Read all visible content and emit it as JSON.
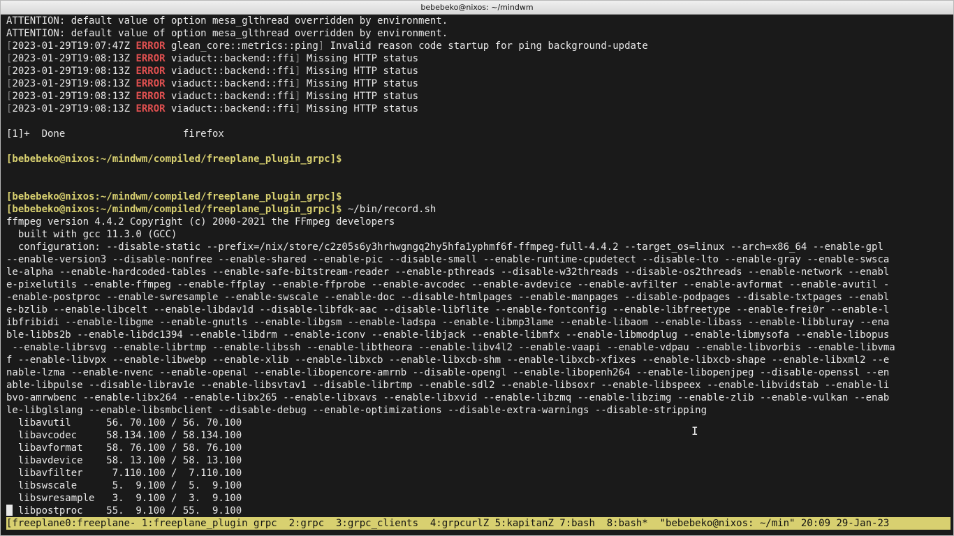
{
  "window": {
    "title": "bebebeko@nixos: ~/mindwm"
  },
  "terminal": {
    "lines": [
      {
        "text": "ATTENTION: default value of option mesa_glthread overridden by environment."
      },
      {
        "text": "ATTENTION: default value of option mesa_glthread overridden by environment."
      },
      {
        "text": "[2023-01-29T19:07:47Z ERROR glean_core::metrics::ping] Invalid reason code startup for ping background-update"
      },
      {
        "text": "[2023-01-29T19:08:13Z ERROR viaduct::backend::ffi] Missing HTTP status"
      },
      {
        "text": "[2023-01-29T19:08:13Z ERROR viaduct::backend::ffi] Missing HTTP status"
      },
      {
        "text": "[2023-01-29T19:08:13Z ERROR viaduct::backend::ffi] Missing HTTP status"
      },
      {
        "text": "[2023-01-29T19:08:13Z ERROR viaduct::backend::ffi] Missing HTTP status"
      },
      {
        "text": "[2023-01-29T19:08:13Z ERROR viaduct::backend::ffi] Missing HTTP status"
      },
      {
        "text": ""
      },
      {
        "text": "[1]+  Done                    firefox"
      },
      {
        "text": ""
      },
      {
        "text": "[bebebeko@nixos:~/mindwm/compiled/freeplane_plugin_grpc]$"
      },
      {
        "text": ""
      },
      {
        "text": ""
      },
      {
        "text": "[bebebeko@nixos:~/mindwm/compiled/freeplane_plugin_grpc]$"
      },
      {
        "text": "[bebebeko@nixos:~/mindwm/compiled/freeplane_plugin_grpc]$ ~/bin/record.sh"
      },
      {
        "text": "ffmpeg version 4.4.2 Copyright (c) 2000-2021 the FFmpeg developers"
      },
      {
        "text": "  built with gcc 11.3.0 (GCC)"
      },
      {
        "text": "  configuration: --disable-static --prefix=/nix/store/c2z05s6y3hrhwgngq2hy5hfa1yphmf6f-ffmpeg-full-4.4.2 --target_os=linux --arch=x86_64 --enable-gpl"
      },
      {
        "text": "--enable-version3 --disable-nonfree --enable-shared --enable-pic --disable-small --enable-runtime-cpudetect --disable-lto --enable-gray --enable-swsca"
      },
      {
        "text": "le-alpha --enable-hardcoded-tables --enable-safe-bitstream-reader --enable-pthreads --disable-w32threads --disable-os2threads --enable-network --enabl"
      },
      {
        "text": "e-pixelutils --enable-ffmpeg --enable-ffplay --enable-ffprobe --enable-avcodec --enable-avdevice --enable-avfilter --enable-avformat --enable-avutil -"
      },
      {
        "text": "-enable-postproc --enable-swresample --enable-swscale --enable-doc --disable-htmlpages --enable-manpages --disable-podpages --disable-txtpages --enabl"
      },
      {
        "text": "e-bzlib --enable-libcelt --enable-libdav1d --disable-libfdk-aac --disable-libflite --enable-fontconfig --enable-libfreetype --enable-frei0r --enable-l"
      },
      {
        "text": "ibfribidi --enable-libgme --enable-gnutls --enable-libgsm --enable-ladspa --enable-libmp3lame --enable-libaom --enable-libass --enable-libbluray --ena"
      },
      {
        "text": "ble-libbs2b --enable-libdc1394 --enable-libdrm --enable-iconv --enable-libjack --enable-libmfx --enable-libmodplug --enable-libmysofa --enable-libopus"
      },
      {
        "text": " --enable-librsvg --enable-librtmp --enable-libssh --enable-libtheora --enable-libv4l2 --enable-vaapi --enable-vdpau --enable-libvorbis --enable-libvma"
      },
      {
        "text": "f --enable-libvpx --enable-libwebp --enable-xlib --enable-libxcb --enable-libxcb-shm --enable-libxcb-xfixes --enable-libxcb-shape --enable-libxml2 --e"
      },
      {
        "text": "nable-lzma --enable-nvenc --enable-openal --enable-libopencore-amrnb --disable-opengl --enable-libopenh264 --enable-libopenjpeg --disable-openssl --en"
      },
      {
        "text": "able-libpulse --disable-librav1e --enable-libsvtav1 --disable-librtmp --enable-sdl2 --enable-libsoxr --enable-libspeex --enable-libvidstab --enable-li"
      },
      {
        "text": "bvo-amrwbenc --enable-libx264 --enable-libx265 --enable-libxavs --enable-libxvid --enable-libzmq --enable-libzimg --enable-zlib --enable-vulkan --enab"
      },
      {
        "text": "le-libglslang --enable-libsmbclient --disable-debug --enable-optimizations --disable-extra-warnings --disable-stripping"
      },
      {
        "text": "  libavutil      56. 70.100 / 56. 70.100"
      },
      {
        "text": "  libavcodec     58.134.100 / 58.134.100"
      },
      {
        "text": "  libavformat    58. 76.100 / 58. 76.100"
      },
      {
        "text": "  libavdevice    58. 13.100 / 58. 13.100"
      },
      {
        "text": "  libavfilter     7.110.100 /  7.110.100"
      },
      {
        "text": "  libswscale      5.  9.100 /  5.  9.100"
      },
      {
        "text": "  libswresample   3.  9.100 /  3.  9.100"
      },
      {
        "text": "  libpostproc    55.  9.100 / 55.  9.100"
      },
      {
        "text": ""
      }
    ]
  },
  "status_bar": {
    "text": "[freeplane0:freeplane- 1:freeplane_plugin grpc  2:grpc  3:grpc_clients  4:grpcurlZ 5:kapitanZ 7:bash  8:bash*  \"bebebeko@nixos: ~/min\" 20:09 29-Jan-23"
  },
  "colors": {
    "background": "#1a1a1a",
    "foreground": "#e8e8e8",
    "error": "#e05050",
    "prompt": "#d8d070",
    "status_bar": "#d8d070"
  },
  "icons": {
    "text_cursor": "ibeam-cursor-icon"
  }
}
